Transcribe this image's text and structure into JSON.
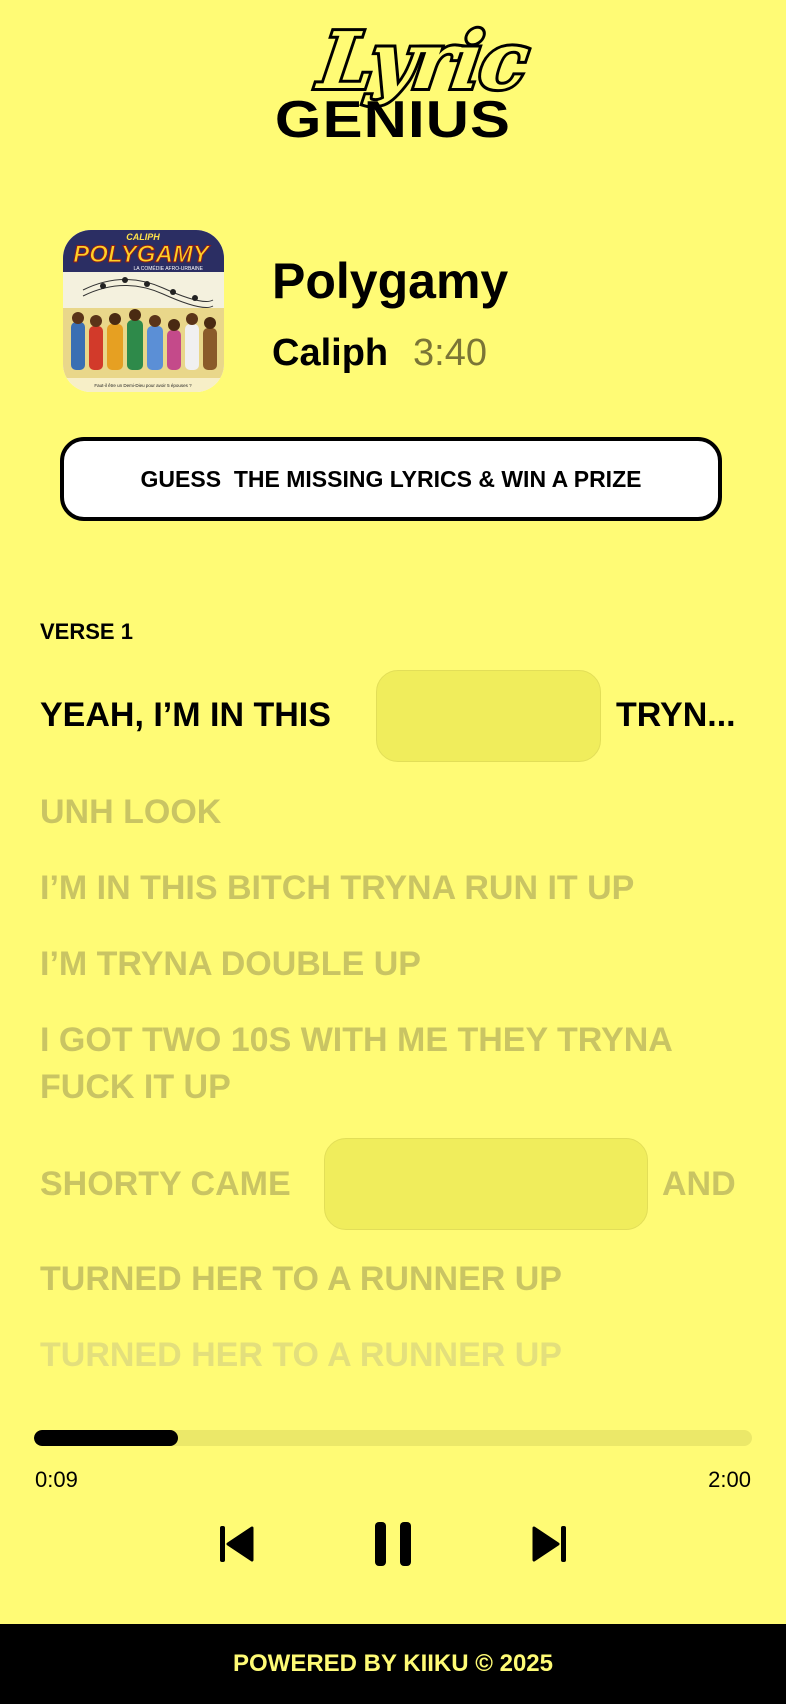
{
  "app": {
    "logo_top": "Lyric",
    "logo_bottom": "GENIUS"
  },
  "song": {
    "title": "Polygamy",
    "artist": "Caliph",
    "duration": "3:40",
    "cover_artist": "CALIPH",
    "cover_title": "POLYGAMY",
    "cover_subtitle": "LA COMÉDIE AFRO-URBAINE",
    "cover_tagline": "Faut-il être un Demi-Dieu pour avoir 5 épouses ?"
  },
  "cta": {
    "label": "GUESS  THE MISSING LYRICS & WIN A PRIZE"
  },
  "lyrics": {
    "verse_label": "VERSE 1",
    "lines": [
      {
        "before": "YEAH, I’M IN THIS",
        "after": "TRYN..."
      },
      {
        "text": "UNH LOOK"
      },
      {
        "text": "I’M IN THIS BITCH TRYNA RUN IT UP"
      },
      {
        "text": "I’M  TRYNA DOUBLE UP"
      },
      {
        "text": "I GOT TWO 10S WITH ME THEY TRYNA"
      },
      {
        "text": "FUCK IT UP"
      },
      {
        "before": "SHORTY CAME",
        "after": "AND"
      },
      {
        "text": "TURNED HER TO A RUNNER UP"
      },
      {
        "text": "TURNED HER TO A RUNNER UP"
      }
    ]
  },
  "player": {
    "elapsed": "0:09",
    "total": "2:00",
    "progress_fraction": 0.2
  },
  "footer": {
    "label": "POWERED BY KIIKU © 2025"
  },
  "colors": {
    "background": "#fffb75",
    "text": "#000000",
    "faded_text": "#c9c463",
    "duration_text": "#7b7536"
  }
}
